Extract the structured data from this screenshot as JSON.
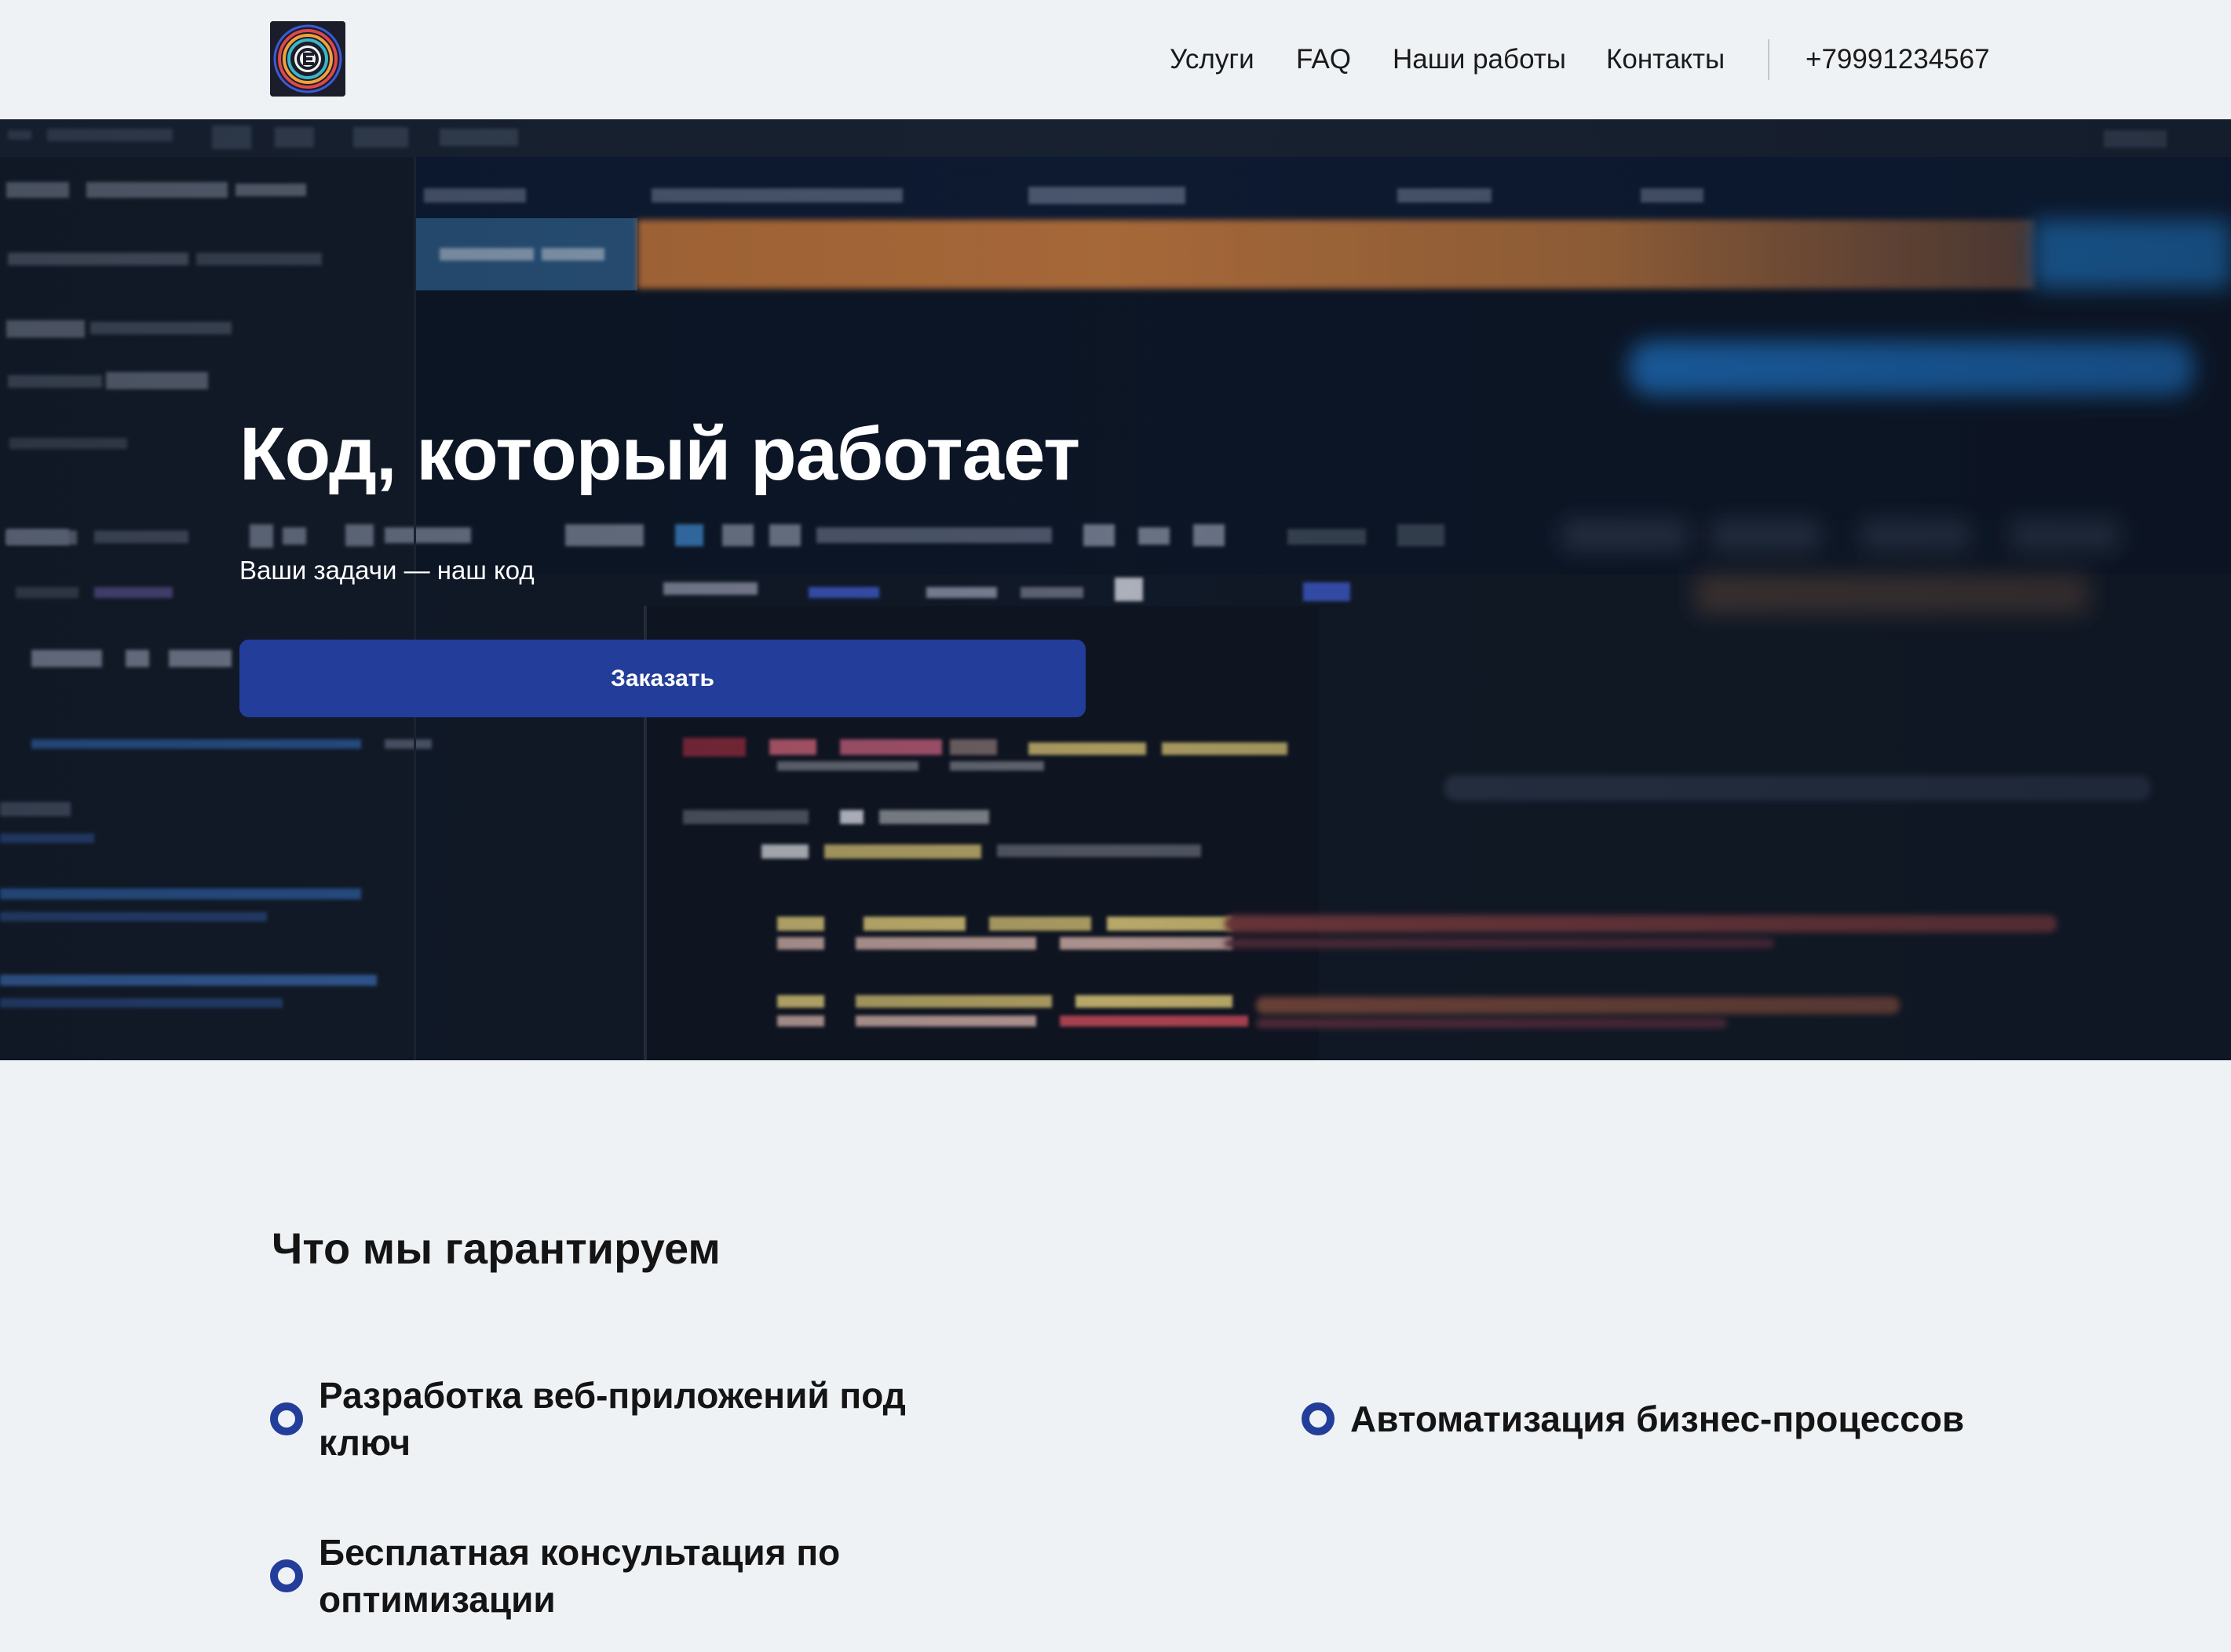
{
  "header": {
    "logo_name": "company-logo",
    "nav": [
      {
        "label": "Услуги"
      },
      {
        "label": "FAQ"
      },
      {
        "label": "Наши работы"
      },
      {
        "label": "Контакты"
      }
    ],
    "phone": "+79991234567"
  },
  "hero": {
    "title": "Код, который работает",
    "subtitle": "Ваши задачи — наш код",
    "cta_label": "Заказать"
  },
  "guarantees": {
    "title": "Что мы гарантируем",
    "items": [
      {
        "text": "Разработка веб-приложений под ключ"
      },
      {
        "text": "Автоматизация бизнес-процессов"
      },
      {
        "text": "Бесплатная консультация по оптимизации"
      }
    ]
  },
  "colors": {
    "background": "#eff2f5",
    "accent": "#233d9a",
    "hero_background": "#0d1522"
  }
}
